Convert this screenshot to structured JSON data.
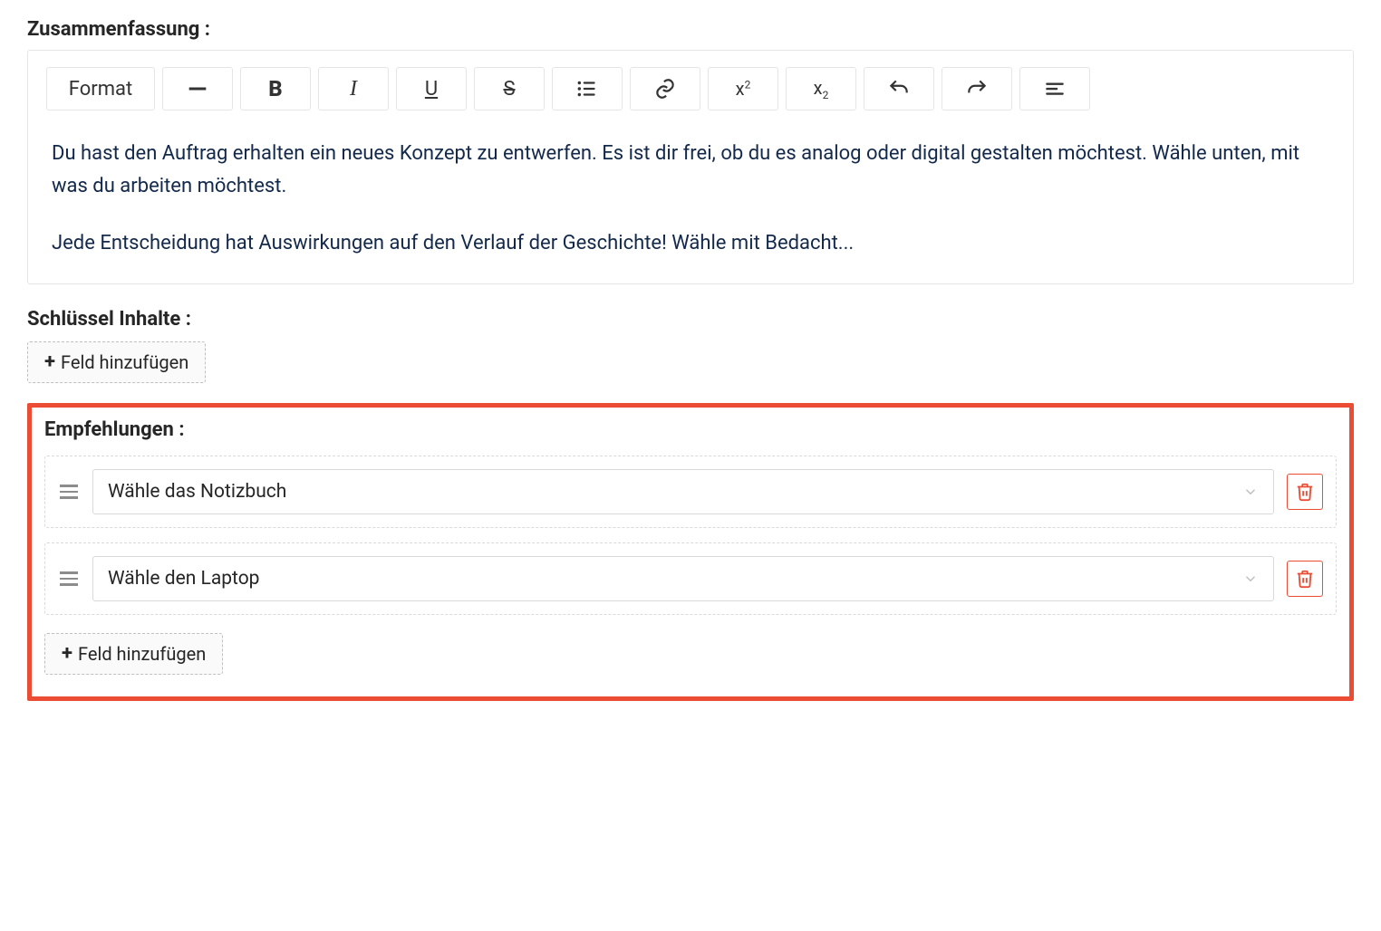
{
  "summary": {
    "label": "Zusammenfassung :",
    "toolbar": {
      "format": "Format"
    },
    "paragraphs": [
      "Du hast den Auftrag erhalten ein neues Konzept zu entwerfen. Es ist dir frei, ob du es analog oder digital gestalten möchtest. Wähle unten, mit was du arbeiten möchtest.",
      "Jede Entscheidung hat Auswirkungen auf den Verlauf der Geschichte! Wähle mit Bedacht..."
    ]
  },
  "key_contents": {
    "label": "Schlüssel Inhalte :",
    "add_label": "Feld hinzufügen"
  },
  "recommendations": {
    "label": "Empfehlungen :",
    "items": [
      {
        "value": "Wähle das Notizbuch"
      },
      {
        "value": "Wähle den Laptop"
      }
    ],
    "add_label": "Feld hinzufügen"
  }
}
